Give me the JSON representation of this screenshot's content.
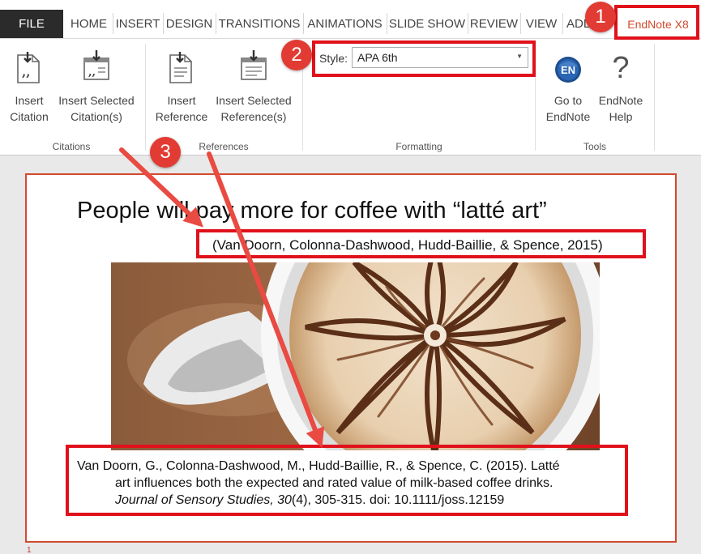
{
  "tabs": [
    "FILE",
    "HOME",
    "INSERT",
    "DESIGN",
    "TRANSITIONS",
    "ANIMATIONS",
    "SLIDE SHOW",
    "REVIEW",
    "VIEW",
    "ADD",
    "EndNote X8"
  ],
  "ribbon": {
    "citations": {
      "group_label": "Citations",
      "insert_citation": [
        "Insert",
        "Citation"
      ],
      "insert_selected_citations": [
        "Insert Selected",
        "Citation(s)"
      ]
    },
    "references": {
      "group_label": "References",
      "insert_reference": [
        "Insert",
        "Reference"
      ],
      "insert_selected_references": [
        "Insert Selected",
        "Reference(s)"
      ]
    },
    "formatting": {
      "group_label": "Formatting",
      "style_label": "Style:",
      "style_value": "APA 6th"
    },
    "tools": {
      "group_label": "Tools",
      "goto_endnote": [
        "Go to",
        "EndNote"
      ],
      "goto_icon_text": "EN",
      "endnote_help": [
        "EndNote",
        "Help"
      ],
      "help_icon_text": "?"
    }
  },
  "slide": {
    "title": "People will pay more for coffee with “latté art”",
    "in_text_citation": "(Van Doorn, Colonna-Dashwood, Hudd-Baillie, & Spence, 2015)",
    "reference": {
      "line1": "Van Doorn, G., Colonna-Dashwood, M., Hudd-Baillie, R., & Spence, C. (2015). Latté",
      "line2": "art influences both the expected and rated value of milk-based coffee drinks.",
      "journal": "Journal of Sensory Studies, 30",
      "issue_pages": "(4), 305-315. doi: 10.1111/joss.12159"
    },
    "number": "1"
  },
  "annotations": {
    "badge_1": "1",
    "badge_2": "2",
    "badge_3": "3"
  },
  "colors": {
    "annotation_red": "#e0111b",
    "endnote_tab": "#d24a2f",
    "file_tab": "#2b2b2b"
  },
  "icons": [
    "insert-citation-icon",
    "insert-selected-citation-icon",
    "insert-reference-icon",
    "insert-selected-reference-icon",
    "endnote-logo-icon",
    "help-icon",
    "dropdown-caret-icon"
  ]
}
